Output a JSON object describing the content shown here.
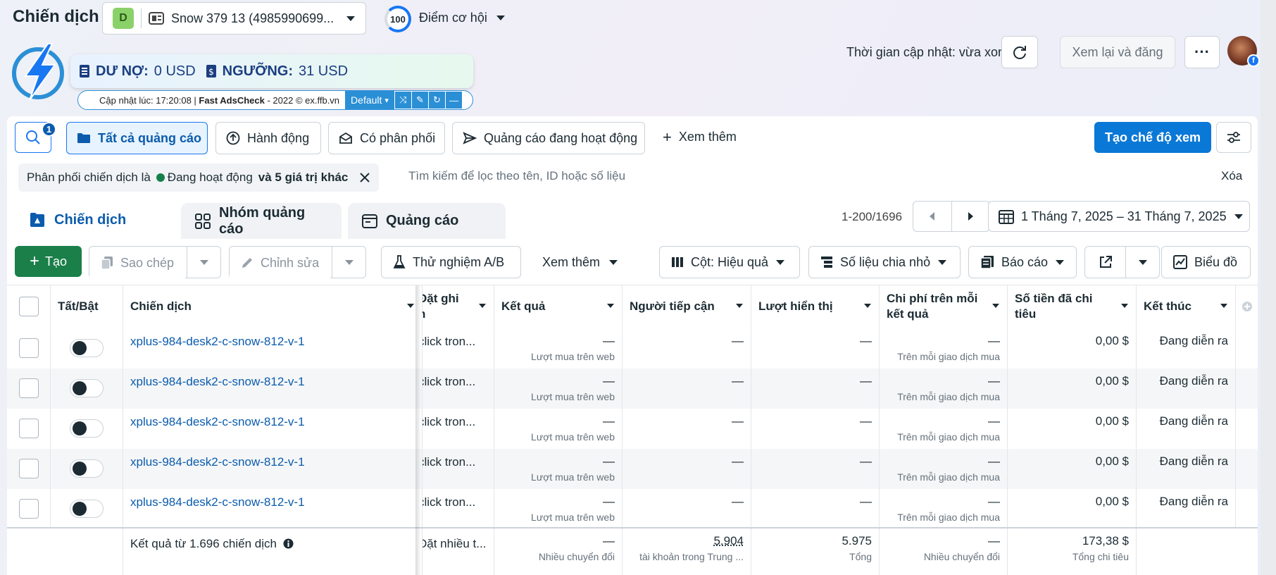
{
  "header": {
    "title": "Chiến dịch",
    "account_badge": "D",
    "account_name": "Snow 379 13 (4985990699...",
    "opportunity_score": "100",
    "opportunity_label": "Điểm cơ hội",
    "update_time": "Thời gian cập nhật: vừa xong",
    "review_publish": "Xem lại và đăng"
  },
  "extension": {
    "debt_label": "DƯ NỢ:",
    "debt_value": "0 USD",
    "threshold_label": "NGƯỠNG:",
    "threshold_value": "31 USD",
    "status_prefix": "Cập nhật lúc: 17:20:08 | ",
    "status_brand": "Fast AdsCheck",
    "status_suffix": " - 2022 © ex.ffb.vn",
    "mode": "Default"
  },
  "filters": {
    "search_badge": "1",
    "buttons": [
      "Tất cả quảng cáo",
      "Hành động",
      "Có phân phối",
      "Quảng cáo đang hoạt động",
      "Xem thêm"
    ],
    "create_view": "Tạo chế độ xem",
    "chip_prefix": "Phân phối chiến dịch là",
    "chip_status": "Đang hoạt động",
    "chip_suffix": "và 5 giá trị khác",
    "search_placeholder": "Tìm kiếm để lọc theo tên, ID hoặc số liệu",
    "clear": "Xóa"
  },
  "tabs": [
    "Chiến dịch",
    "Nhóm quảng cáo",
    "Quảng cáo"
  ],
  "pagination": "1-200/1696",
  "date_range": "1 Tháng 7, 2025 – 31 Tháng 7, 2025",
  "toolbar": {
    "create": "Tạo",
    "copy": "Sao chép",
    "edit": "Chỉnh sửa",
    "ab_test": "Thử nghiệm A/B",
    "more": "Xem thêm",
    "columns": "Cột: Hiệu quả",
    "breakdown": "Số liệu chia nhỏ",
    "reports": "Báo cáo",
    "chart": "Biểu đồ"
  },
  "table": {
    "headers": {
      "toggle": "Tất/Bật",
      "campaign": "Chiến dịch",
      "bid": "Đặt ghi",
      "bid2": "n",
      "results": "Kết quả",
      "reach": "Người tiếp cận",
      "impressions": "Lượt hiển thị",
      "cost_per_result": "Chi phí trên mỗi kết quả",
      "amount_spent": "Số tiền đã chi tiêu",
      "ends": "Kết thúc"
    },
    "rows": [
      {
        "name": "xplus-984-desk2-c-snow-812-v-1",
        "bid": "click tron...",
        "results": "—",
        "results_sub": "Lượt mua trên web",
        "reach": "—",
        "impressions": "—",
        "cpr": "—",
        "cpr_sub": "Trên mỗi giao dịch mua",
        "spent": "0,00 $",
        "ends": "Đang diễn ra"
      },
      {
        "name": "xplus-984-desk2-c-snow-812-v-1",
        "bid": "click tron...",
        "results": "—",
        "results_sub": "Lượt mua trên web",
        "reach": "—",
        "impressions": "—",
        "cpr": "—",
        "cpr_sub": "Trên mỗi giao dịch mua",
        "spent": "0,00 $",
        "ends": "Đang diễn ra"
      },
      {
        "name": "xplus-984-desk2-c-snow-812-v-1",
        "bid": "click tron...",
        "results": "—",
        "results_sub": "Lượt mua trên web",
        "reach": "—",
        "impressions": "—",
        "cpr": "—",
        "cpr_sub": "Trên mỗi giao dịch mua",
        "spent": "0,00 $",
        "ends": "Đang diễn ra"
      },
      {
        "name": "xplus-984-desk2-c-snow-812-v-1",
        "bid": "click tron...",
        "results": "—",
        "results_sub": "Lượt mua trên web",
        "reach": "—",
        "impressions": "—",
        "cpr": "—",
        "cpr_sub": "Trên mỗi giao dịch mua",
        "spent": "0,00 $",
        "ends": "Đang diễn ra"
      },
      {
        "name": "xplus-984-desk2-c-snow-812-v-1",
        "bid": "click tron...",
        "results": "—",
        "results_sub": "Lượt mua trên web",
        "reach": "—",
        "impressions": "—",
        "cpr": "—",
        "cpr_sub": "Trên mỗi giao dịch mua",
        "spent": "0,00 $",
        "ends": "Đang diễn ra"
      }
    ],
    "summary": {
      "label": "Kết quả từ 1.696 chiến dịch",
      "bid": "Đặt nhiều t...",
      "results": "—",
      "results_sub": "Nhiều chuyển đổi",
      "reach": "5.904",
      "reach_sub": "tài khoản trong Trung ...",
      "impressions": "5.975",
      "impressions_sub": "Tổng",
      "cpr": "—",
      "cpr_sub": "Nhiều chuyển đổi",
      "spent": "173,38 $",
      "spent_sub": "Tổng chi tiêu"
    }
  },
  "colors": {
    "primary": "#0a78d6",
    "link": "#0b5cad",
    "create_green": "#1a7f49",
    "active_dot": "#16804a"
  }
}
